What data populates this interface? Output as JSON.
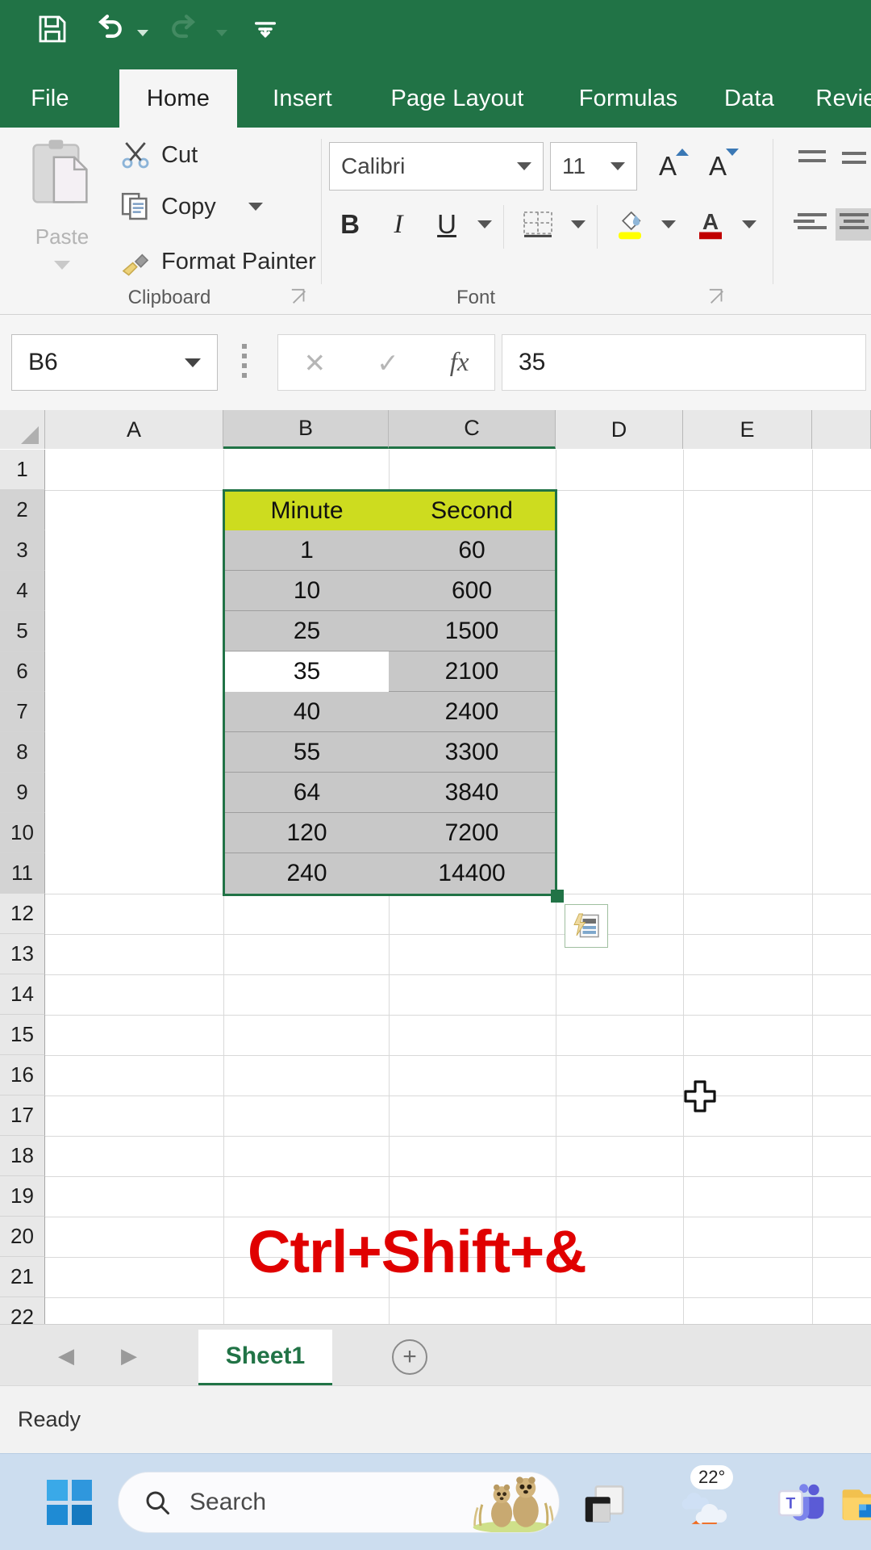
{
  "app": {
    "name": "Microsoft Excel",
    "theme_green": "#217346",
    "accent_yellow": "#cddc1f",
    "overlay_red": "#e00000"
  },
  "quick_access": {
    "items": [
      {
        "name": "save-icon",
        "label": "Save"
      },
      {
        "name": "undo-icon",
        "label": "Undo"
      },
      {
        "name": "redo-icon",
        "label": "Redo"
      },
      {
        "name": "customize-quick-access-icon",
        "label": "Customize Quick Access Toolbar"
      }
    ]
  },
  "ribbon": {
    "tabs": [
      {
        "label": "File",
        "active": false
      },
      {
        "label": "Home",
        "active": true
      },
      {
        "label": "Insert",
        "active": false
      },
      {
        "label": "Page Layout",
        "active": false
      },
      {
        "label": "Formulas",
        "active": false
      },
      {
        "label": "Data",
        "active": false
      },
      {
        "label": "Revie",
        "active": false
      }
    ],
    "clipboard": {
      "group_label": "Clipboard",
      "paste_label": "Paste",
      "cut_label": "Cut",
      "copy_label": "Copy",
      "format_painter_label": "Format Painter"
    },
    "font": {
      "group_label": "Font",
      "font_family_value": "Calibri",
      "font_size_value": "11",
      "grow_font_label": "A",
      "shrink_font_label": "A",
      "bold_label": "B",
      "italic_label": "I",
      "underline_label": "U",
      "fill_color": "#ffff00",
      "font_color": "#c00000"
    },
    "alignment": {
      "vertical": [
        "top-align",
        "middle-align",
        "bottom-align"
      ],
      "horizontal": [
        "align-left",
        "center",
        "align-right"
      ],
      "vertical_selected": "bottom-align",
      "horizontal_selected": "center"
    }
  },
  "formula_bar": {
    "name_box_value": "B6",
    "cancel_label": "✕",
    "enter_label": "✓",
    "insert_function_label": "fx",
    "formula_value": "35"
  },
  "grid": {
    "columns": [
      "A",
      "B",
      "C",
      "D",
      "E"
    ],
    "selected_columns": [
      "B",
      "C"
    ],
    "rows": [
      "1",
      "2",
      "3",
      "4",
      "5",
      "6",
      "7",
      "8",
      "9",
      "10",
      "11",
      "12",
      "13",
      "14",
      "15",
      "16",
      "17",
      "18",
      "19",
      "20",
      "21",
      "22"
    ],
    "selected_rows": [
      "2",
      "3",
      "4",
      "5",
      "6",
      "7",
      "8",
      "9",
      "10",
      "11"
    ],
    "table": {
      "headers": [
        "Minute",
        "Second"
      ],
      "rows": [
        [
          "1",
          "60"
        ],
        [
          "10",
          "600"
        ],
        [
          "25",
          "1500"
        ],
        [
          "35",
          "2100"
        ],
        [
          "40",
          "2400"
        ],
        [
          "55",
          "3300"
        ],
        [
          "64",
          "3840"
        ],
        [
          "120",
          "7200"
        ],
        [
          "240",
          "14400"
        ]
      ],
      "active_cell": "B6",
      "active_row_index": 3
    },
    "quick_analysis_label": "Quick Analysis",
    "overlay_text": "Ctrl+Shift+&"
  },
  "sheet_tabs": {
    "prev_label": "◀",
    "next_label": "▶",
    "tabs": [
      {
        "label": "Sheet1",
        "active": true
      }
    ],
    "add_sheet_label": "+"
  },
  "status_bar": {
    "status": "Ready"
  },
  "taskbar": {
    "start_label": "Start",
    "search_placeholder": "Search",
    "search_value": "Search",
    "items": [
      {
        "name": "task-view-icon",
        "label": "Task View"
      },
      {
        "name": "weather-icon",
        "label": "22°"
      },
      {
        "name": "teams-icon",
        "label": "Microsoft Teams"
      },
      {
        "name": "file-explorer-icon",
        "label": "File Explorer"
      }
    ],
    "weather_temp": "22°"
  }
}
